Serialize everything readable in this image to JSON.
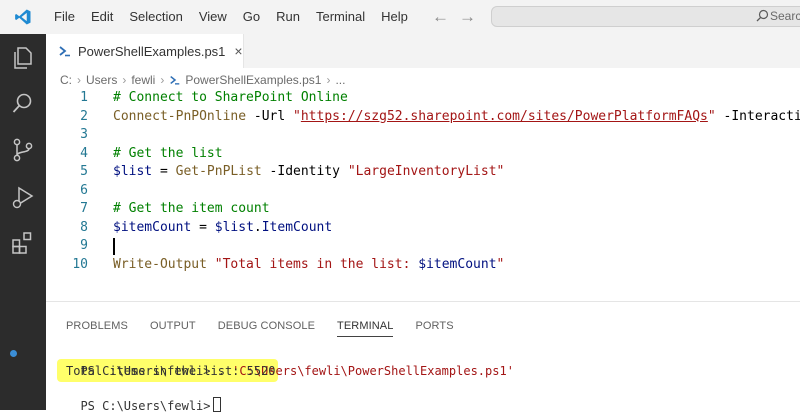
{
  "menu": [
    "File",
    "Edit",
    "Selection",
    "View",
    "Go",
    "Run",
    "Terminal",
    "Help"
  ],
  "titlebar": {
    "search_placeholder": "Search"
  },
  "tab": {
    "label": "PowerShellExamples.ps1",
    "close": "×"
  },
  "breadcrumb": [
    "C:",
    "Users",
    "fewli",
    "PowerShellExamples.ps1",
    "..."
  ],
  "editor": {
    "lines": [
      {
        "number": "1",
        "parts": [
          {
            "t": "# Connect to SharePoint Online",
            "k": "comment"
          }
        ]
      },
      {
        "number": "2",
        "parts": [
          {
            "t": "Connect-PnPOnline",
            "k": "cmd"
          },
          {
            "t": " -Url ",
            "k": "param"
          },
          {
            "t": "\"",
            "k": "str"
          },
          {
            "t": "https://szg52.sharepoint.com/sites/PowerPlatformFAQs",
            "k": "url"
          },
          {
            "t": "\"",
            "k": "str"
          },
          {
            "t": " -Interactive",
            "k": "param"
          }
        ]
      },
      {
        "number": "3",
        "parts": []
      },
      {
        "number": "4",
        "parts": [
          {
            "t": "# Get the list",
            "k": "comment"
          }
        ]
      },
      {
        "number": "5",
        "parts": [
          {
            "t": "$list",
            "k": "var"
          },
          {
            "t": " = ",
            "k": "op"
          },
          {
            "t": "Get-PnPList",
            "k": "cmd"
          },
          {
            "t": " -Identity ",
            "k": "param"
          },
          {
            "t": "\"LargeInventoryList\"",
            "k": "str"
          }
        ]
      },
      {
        "number": "6",
        "parts": []
      },
      {
        "number": "7",
        "parts": [
          {
            "t": "# Get the item count",
            "k": "comment"
          }
        ]
      },
      {
        "number": "8",
        "parts": [
          {
            "t": "$itemCount",
            "k": "var"
          },
          {
            "t": " = ",
            "k": "op"
          },
          {
            "t": "$list",
            "k": "var"
          },
          {
            "t": ".",
            "k": "op"
          },
          {
            "t": "ItemCount",
            "k": "member"
          }
        ]
      },
      {
        "number": "9",
        "parts": [],
        "cursor": true
      },
      {
        "number": "10",
        "parts": [
          {
            "t": "Write-Output",
            "k": "cmd"
          },
          {
            "t": " ",
            "k": "op"
          },
          {
            "t": "\"Total items in the list: ",
            "k": "str"
          },
          {
            "t": "$itemCount",
            "k": "var"
          },
          {
            "t": "\"",
            "k": "str"
          }
        ]
      }
    ]
  },
  "panel": {
    "tabs": [
      "PROBLEMS",
      "OUTPUT",
      "DEBUG CONSOLE",
      "TERMINAL",
      "PORTS"
    ],
    "active_tab": "TERMINAL",
    "terminal": {
      "line1_prompt": "PS C:\\Users\\fewli> . ",
      "line1_path": "'C:\\Users\\fewli\\PowerShellExamples.ps1'",
      "line2": "Total items in the list: 5520",
      "line3_prompt": "PS C:\\Users\\fewli>"
    }
  },
  "colors": {
    "accent": "#007acc",
    "activity_bar": "#2c2c2c",
    "highlight": "#ffff6a",
    "terminal_dot": "#3b8ed6"
  },
  "icons": [
    "vscode-logo-icon",
    "explorer-icon",
    "search-icon",
    "source-control-icon",
    "run-debug-icon",
    "extensions-icon",
    "powershell-file-icon"
  ]
}
